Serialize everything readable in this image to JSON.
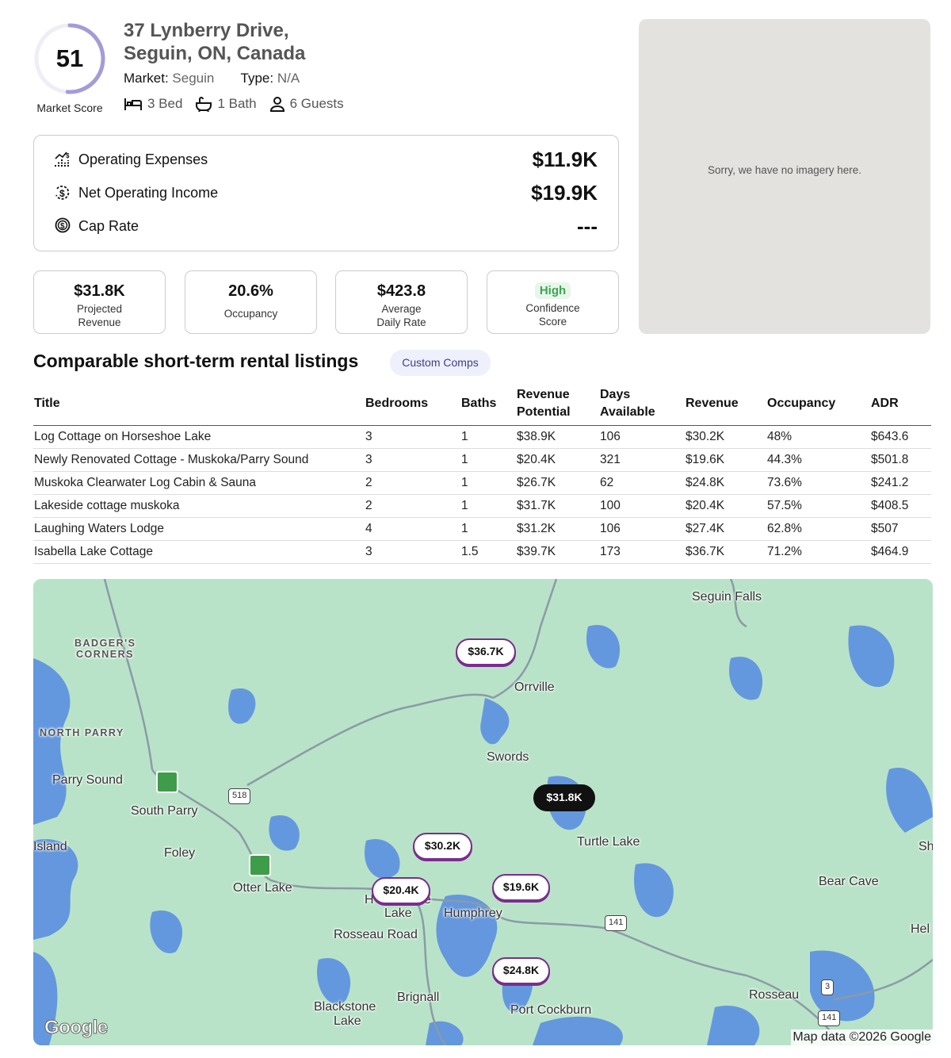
{
  "property": {
    "score": "51",
    "score_fraction": 0.51,
    "score_label": "Market Score",
    "address_line1": "37 Lynberry Drive,",
    "address_line2": "Seguin, ON, Canada",
    "market_label": "Market:",
    "market_value": "Seguin",
    "type_label": "Type:",
    "type_value": "N/A",
    "beds": "3 Bed",
    "baths": "1 Bath",
    "guests": "6 Guests"
  },
  "financials": [
    {
      "label": "Operating Expenses",
      "value": "$11.9K",
      "icon": "chart-icon"
    },
    {
      "label": "Net Operating Income",
      "value": "$19.9K",
      "icon": "dollar-cycle-icon"
    },
    {
      "label": "Cap Rate",
      "value": "---",
      "icon": "coin-icon"
    }
  ],
  "stats": {
    "revenue_value": "$31.8K",
    "revenue_label1": "Projected",
    "revenue_label2": "Revenue",
    "occupancy_value": "20.6%",
    "occupancy_label": "Occupancy",
    "adr_value": "$423.8",
    "adr_label1": "Average",
    "adr_label2": "Daily Rate",
    "confidence_value": "High",
    "confidence_label1": "Confidence",
    "confidence_label2": "Score"
  },
  "imagery_message": "Sorry, we have no imagery here.",
  "comps": {
    "title": "Comparable short-term rental listings",
    "button": "Custom Comps",
    "headers": {
      "title": "Title",
      "bedrooms": "Bedrooms",
      "baths": "Baths",
      "rev_pot_1": "Revenue",
      "rev_pot_2": "Potential",
      "days_1": "Days",
      "days_2": "Available",
      "revenue": "Revenue",
      "occupancy": "Occupancy",
      "adr": "ADR"
    },
    "rows": [
      {
        "title": "Log Cottage on Horseshoe Lake",
        "bedrooms": "3",
        "baths": "1",
        "revenue_potential": "$38.9K",
        "days": "106",
        "revenue": "$30.2K",
        "occupancy": "48%",
        "adr": "$643.6"
      },
      {
        "title": "Newly Renovated Cottage - Muskoka/Parry Sound",
        "bedrooms": "3",
        "baths": "1",
        "revenue_potential": "$20.4K",
        "days": "321",
        "revenue": "$19.6K",
        "occupancy": "44.3%",
        "adr": "$501.8"
      },
      {
        "title": "Muskoka Clearwater Log Cabin & Sauna",
        "bedrooms": "2",
        "baths": "1",
        "revenue_potential": "$26.7K",
        "days": "62",
        "revenue": "$24.8K",
        "occupancy": "73.6%",
        "adr": "$241.2"
      },
      {
        "title": "Lakeside cottage muskoka",
        "bedrooms": "2",
        "baths": "1",
        "revenue_potential": "$31.7K",
        "days": "100",
        "revenue": "$20.4K",
        "occupancy": "57.5%",
        "adr": "$408.5"
      },
      {
        "title": "Laughing Waters Lodge",
        "bedrooms": "4",
        "baths": "1",
        "revenue_potential": "$31.2K",
        "days": "106",
        "revenue": "$27.4K",
        "occupancy": "62.8%",
        "adr": "$507"
      },
      {
        "title": "Isabella Lake Cottage",
        "bedrooms": "3",
        "baths": "1.5",
        "revenue_potential": "$39.7K",
        "days": "173",
        "revenue": "$36.7K",
        "occupancy": "71.2%",
        "adr": "$464.9"
      }
    ]
  },
  "map": {
    "pins": [
      "$36.7K",
      "$31.8K",
      "$30.2K",
      "$20.4K",
      "$19.6K",
      "$24.8K"
    ],
    "places": [
      "Seguin Falls",
      "BADGER'S",
      "CORNERS",
      "Orrville",
      "NORTH PARRY",
      "Swords",
      "Parry Sound",
      "South Parry",
      "Island",
      "Foley",
      "Turtle Lake",
      "Otter Lake",
      "Bear Cave",
      "Lake",
      "Humphrey",
      "Rosseau Road",
      "Blackstone",
      "Lake",
      "Brignall",
      "Port Cockburn",
      "Rosseau",
      "Sh",
      "Hel",
      "H",
      "e"
    ],
    "shields": [
      "518",
      "141",
      "3",
      "141"
    ],
    "logo": "Google",
    "attribution": "Map data ©2026 Google",
    "water_color": "#4a7fd6",
    "land_color": "#b9e3c8",
    "pin_color": "#7b2c8e"
  }
}
